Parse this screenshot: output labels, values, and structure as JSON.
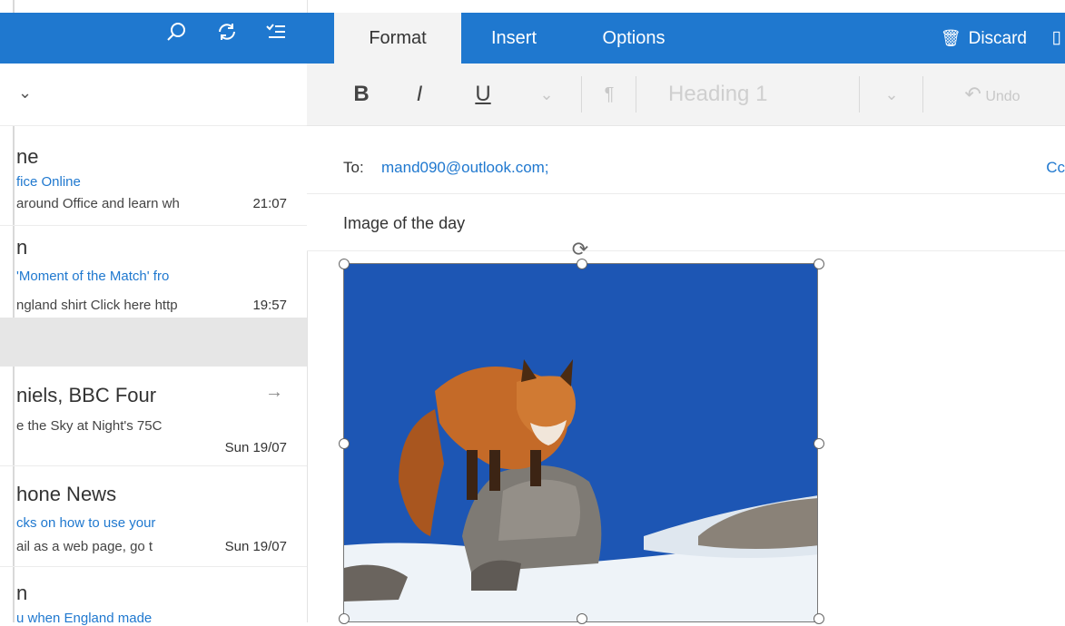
{
  "left_header": {
    "icons": [
      "search-icon",
      "sync-icon",
      "filter-icon"
    ]
  },
  "messages": [
    {
      "sender": "ne",
      "subject": "fice Online",
      "preview": "around Office and learn wh",
      "time": "21:07",
      "read": false
    },
    {
      "sender": "n",
      "subject": "'Moment of the Match' fro",
      "preview": "ngland shirt Click here http",
      "time": "19:57",
      "read": false
    },
    {
      "sender": "niels, BBC Four",
      "subject": "",
      "preview": "e the Sky at Night's 75C",
      "time": "Sun 19/07",
      "read": true
    },
    {
      "sender": "hone News",
      "subject": "cks on how to use your",
      "preview": "ail as a web page, go t",
      "time": "Sun 19/07",
      "read": false
    },
    {
      "sender": "n",
      "subject": "u when England made",
      "preview": "",
      "time": "",
      "read": false
    }
  ],
  "ribbon": {
    "tabs": [
      "Format",
      "Insert",
      "Options"
    ],
    "active_tab": "Format",
    "discard_label": "Discard"
  },
  "toolbar": {
    "bold": "B",
    "italic": "I",
    "underline": "U",
    "style": "Heading 1",
    "undo": "Undo"
  },
  "compose": {
    "to_label": "To:",
    "to_value": "mand090@outlook.com;",
    "cc_label": "Cc",
    "subject": "Image of the day"
  },
  "colors": {
    "accent": "#1f78cf",
    "sky": "#1d56b4",
    "snow": "#eef3f8"
  }
}
